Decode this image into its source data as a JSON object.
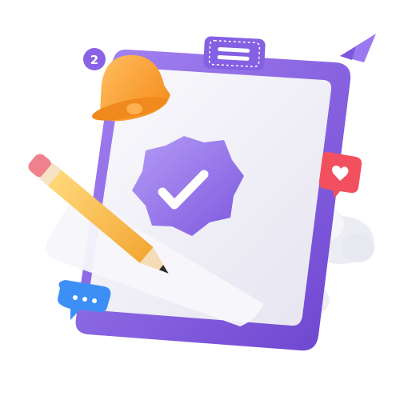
{
  "illustration": {
    "bell_badge_count": "2",
    "colors": {
      "clipboard_frame": "#8a62e6",
      "clipboard_frame_dark": "#6f47d2",
      "paper": "#f3f2f8",
      "badge": "#9a79ee",
      "bell": "#ffa12e",
      "pencil_body": "#ffc24a",
      "pencil_eraser": "#f07a86",
      "chat_bubble": "#3d8ef5",
      "heart_bubble": "#f2505f",
      "cloud": "#f2f2f7",
      "paper_plane": "#9b78f0"
    },
    "icons": [
      "clipboard-icon",
      "verified-check-badge-icon",
      "bell-icon",
      "pencil-icon",
      "chat-bubble-icon",
      "heart-bubble-icon",
      "cloud-icon",
      "paper-plane-icon"
    ]
  }
}
